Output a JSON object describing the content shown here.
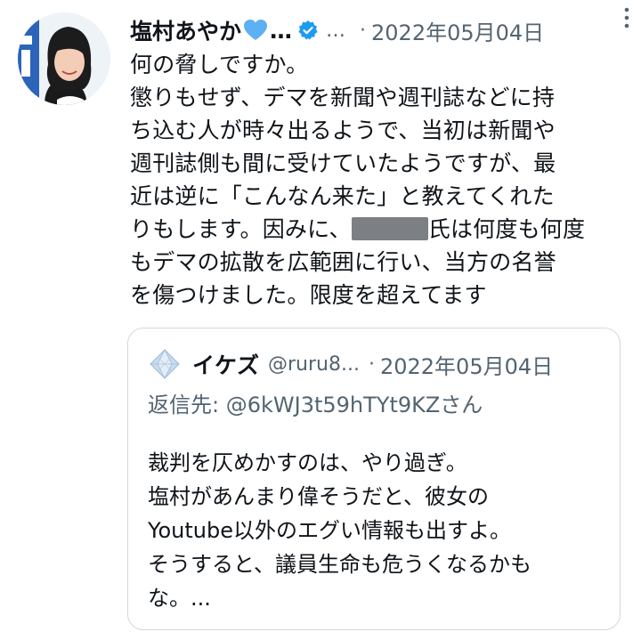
{
  "author": {
    "name": "塩村あやか",
    "name_ellipsis": "…",
    "heart_emoji_color": "#5db0f2",
    "verified_color": "#1d9bf0",
    "handle_ellipsis": "…",
    "separator": "·",
    "date": "2022年05月04日",
    "more_icon": "more-vertical-icon"
  },
  "tweet": {
    "lines": [
      "何の脅しですか。",
      "懲りもせず、デマを新聞や週刊誌などに持",
      "ち込む人が時々出るようで、当初は新聞や",
      "週刊誌側も間に受けていたようですが、最",
      "近は逆に「こんなん来た」と教えてくれた",
      "りもします。因みに、",
      "氏は何度も何度",
      "もデマの拡散を広範囲に行い、当方の名誉",
      "を傷つけました。限度を超えてます"
    ]
  },
  "quoted": {
    "name": "イケズ",
    "handle": "@ruru8...",
    "separator": "·",
    "date": "2022年05月04日",
    "reply_to": "返信先: @6kWJ3t59hTYt9KZさん",
    "lines": [
      "裁判を仄めかすのは、やり過ぎ。",
      "塩村があんまり偉そうだと、彼女の",
      "Youtube以外のエグい情報も出すよ。",
      "そうすると、議員生命も危うくなるかも",
      "な。..."
    ]
  },
  "colors": {
    "text": "#0f1419",
    "secondary": "#536471",
    "border": "#cfd9de",
    "redaction": "#7c7f83"
  }
}
